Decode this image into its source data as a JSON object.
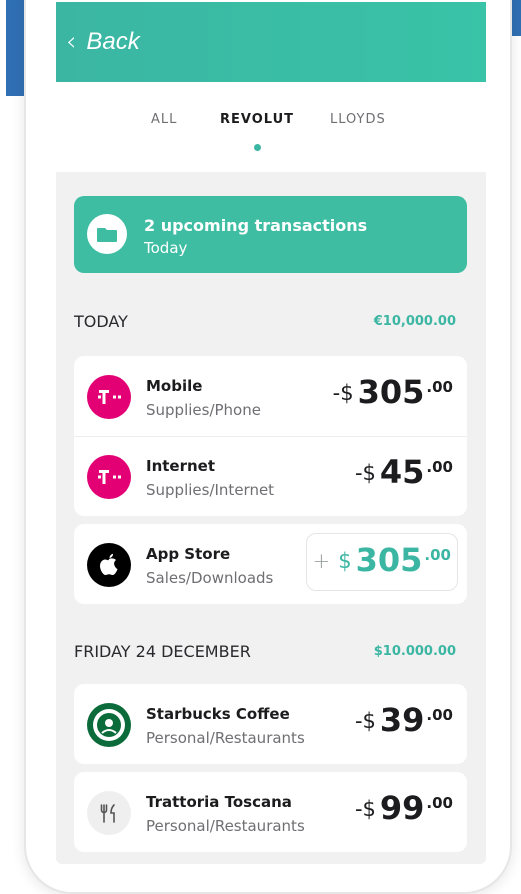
{
  "header": {
    "back_label": "Back"
  },
  "tabs": [
    {
      "label": "ALL"
    },
    {
      "label": "REVOLUT"
    },
    {
      "label": "LLOYDS"
    }
  ],
  "banner": {
    "title": "2 upcoming transactions",
    "subtitle": "Today"
  },
  "sections": [
    {
      "title": "TODAY",
      "amount": "€10,000.00",
      "transactions": [
        {
          "name": "Mobile",
          "category": "Supplies/Phone",
          "sign": "-$",
          "whole": "305",
          "cents": ".00",
          "logo": "t-mobile-logo"
        },
        {
          "name": "Internet",
          "category": "Supplies/Internet",
          "sign": "-$",
          "whole": "45",
          "cents": ".00",
          "logo": "t-mobile-logo"
        },
        {
          "name": "App Store",
          "category": "Sales/Downloads",
          "sign_plus": "+",
          "sign": "$",
          "whole": "305",
          "cents": ".00",
          "logo": "apple-logo"
        }
      ]
    },
    {
      "title": "FRIDAY 24 DECEMBER",
      "amount": "$10.000.00",
      "transactions": [
        {
          "name": "Starbucks Coffee",
          "category": "Personal/Restaurants",
          "sign": "-$",
          "whole": "39",
          "cents": ".00",
          "logo": "starbucks-logo"
        },
        {
          "name": "Trattoria Toscana",
          "category": "Personal/Restaurants",
          "sign": "-$",
          "whole": "99",
          "cents": ".00",
          "logo": "cutlery-icon"
        }
      ]
    }
  ],
  "colors": {
    "accent": "#3bb6a3",
    "tmobile": "#e20074",
    "sidebar_blue": "#2f6fb3"
  }
}
